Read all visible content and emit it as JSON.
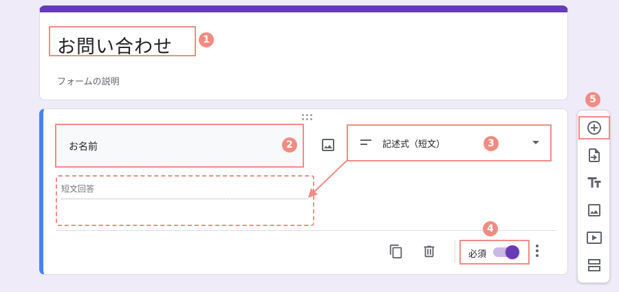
{
  "form": {
    "title": "お問い合わせ",
    "description": "フォームの説明"
  },
  "question": {
    "title": "お名前",
    "type_label": "記述式（短文）",
    "answer_placeholder": "短文回答",
    "required_label": "必須",
    "required": true
  },
  "annotations": [
    "1",
    "2",
    "3",
    "4",
    "5"
  ],
  "icons": {
    "image": "image-icon",
    "type": "short-answer-icon",
    "copy": "copy-icon",
    "delete": "trash-icon",
    "more": "more-vert-icon",
    "add_question": "add-circle-icon",
    "import": "import-questions-icon",
    "title_text": "text-title-icon",
    "add_image": "image-icon",
    "add_video": "video-icon",
    "add_section": "section-icon"
  },
  "colors": {
    "theme": "#673ab7",
    "question_accent": "#4285f4",
    "annotation": "#f28b82",
    "background": "#efebf8"
  }
}
